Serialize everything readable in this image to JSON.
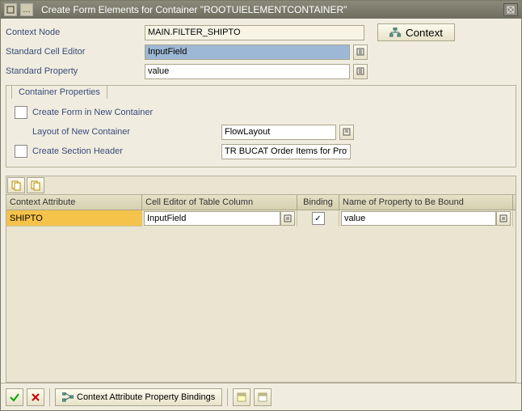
{
  "titlebar": {
    "title": "Create Form Elements for Container \"ROOTUIELEMENTCONTAINER\""
  },
  "fields": {
    "context_node_label": "Context Node",
    "context_node_value": "MAIN.FILTER_SHIPTO",
    "context_btn": "Context",
    "std_cell_editor_label": "Standard Cell Editor",
    "std_cell_editor_value": "InputField",
    "std_property_label": "Standard Property",
    "std_property_value": "value"
  },
  "panel": {
    "title": "Container Properties",
    "create_form_label": "Create Form in New Container",
    "layout_label": "Layout of New Container",
    "layout_value": "FlowLayout",
    "create_section_label": "Create Section Header",
    "section_value": "TR BUCAT Order Items for Profor…"
  },
  "grid": {
    "headers": {
      "attr": "Context Attribute",
      "editor": "Cell Editor of Table Column",
      "binding": "Binding",
      "propname": "Name of Property to Be Bound"
    },
    "rows": [
      {
        "attr": "SHIPTO",
        "editor": "InputField",
        "binding": true,
        "propname": "value"
      }
    ]
  },
  "footer": {
    "bindings_btn": "Context Attribute Property Bindings"
  }
}
